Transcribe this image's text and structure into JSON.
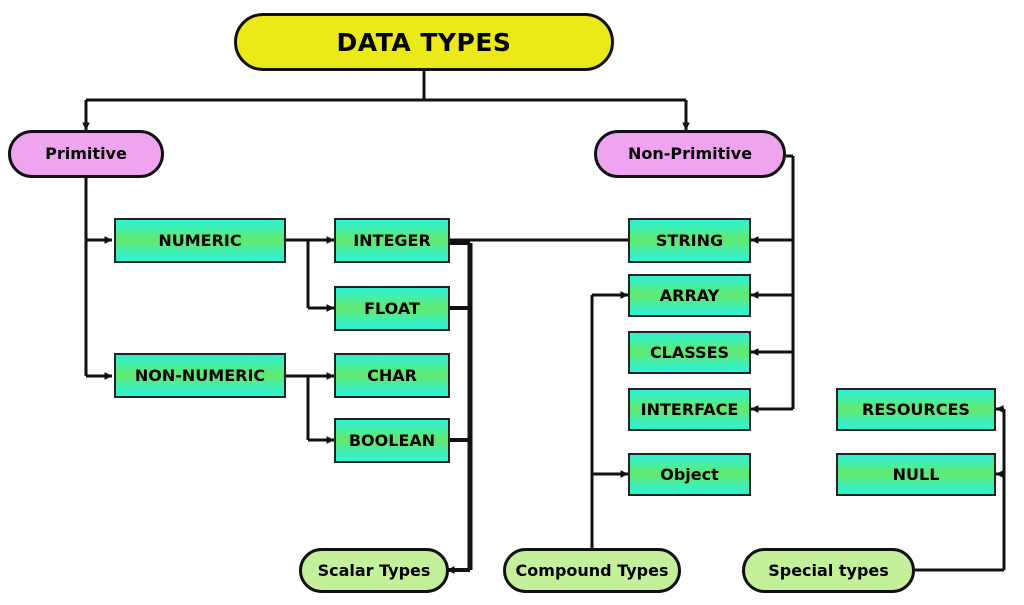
{
  "diagram": {
    "title": "DATA TYPES",
    "colors": {
      "root_fill": "#ece918",
      "branch_fill": "#efa4ef",
      "bottom_fill": "#c4f09c",
      "box_gradient_cyan": "#2bf2d8",
      "box_gradient_green": "#64e86a",
      "stroke": "#111111"
    },
    "nodes": {
      "root": {
        "label": "DATA TYPES"
      },
      "primitive": {
        "label": "Primitive"
      },
      "non_primitive": {
        "label": "Non-Primitive"
      },
      "numeric": {
        "label": "NUMERIC"
      },
      "non_numeric": {
        "label": "NON-NUMERIC"
      },
      "integer": {
        "label": "INTEGER"
      },
      "float": {
        "label": "FLOAT"
      },
      "char": {
        "label": "CHAR"
      },
      "boolean": {
        "label": "BOOLEAN"
      },
      "string": {
        "label": "STRING"
      },
      "array": {
        "label": "ARRAY"
      },
      "classes": {
        "label": "CLASSES"
      },
      "interface": {
        "label": "INTERFACE"
      },
      "object": {
        "label": "Object"
      },
      "resources": {
        "label": "RESOURCES"
      },
      "null": {
        "label": "NULL"
      },
      "scalar_types": {
        "label": "Scalar Types"
      },
      "compound_types": {
        "label": "Compound Types"
      },
      "special_types": {
        "label": "Special types"
      }
    },
    "edges": [
      {
        "from": "root",
        "to": "primitive"
      },
      {
        "from": "root",
        "to": "non_primitive"
      },
      {
        "from": "primitive",
        "to": "numeric"
      },
      {
        "from": "primitive",
        "to": "non_numeric"
      },
      {
        "from": "numeric",
        "to": "integer"
      },
      {
        "from": "numeric",
        "to": "float"
      },
      {
        "from": "non_numeric",
        "to": "char"
      },
      {
        "from": "non_numeric",
        "to": "boolean"
      },
      {
        "from": "integer",
        "to": "string"
      },
      {
        "from": "integer",
        "to": "scalar_types"
      },
      {
        "from": "float",
        "to": "scalar_types"
      },
      {
        "from": "boolean",
        "to": "scalar_types"
      },
      {
        "from": "non_primitive",
        "to": "string"
      },
      {
        "from": "non_primitive",
        "to": "array"
      },
      {
        "from": "non_primitive",
        "to": "classes"
      },
      {
        "from": "non_primitive",
        "to": "interface"
      },
      {
        "from": "compound_types",
        "to": "array"
      },
      {
        "from": "compound_types",
        "to": "object"
      },
      {
        "from": "special_types",
        "to": "resources"
      },
      {
        "from": "special_types",
        "to": "null"
      }
    ]
  }
}
